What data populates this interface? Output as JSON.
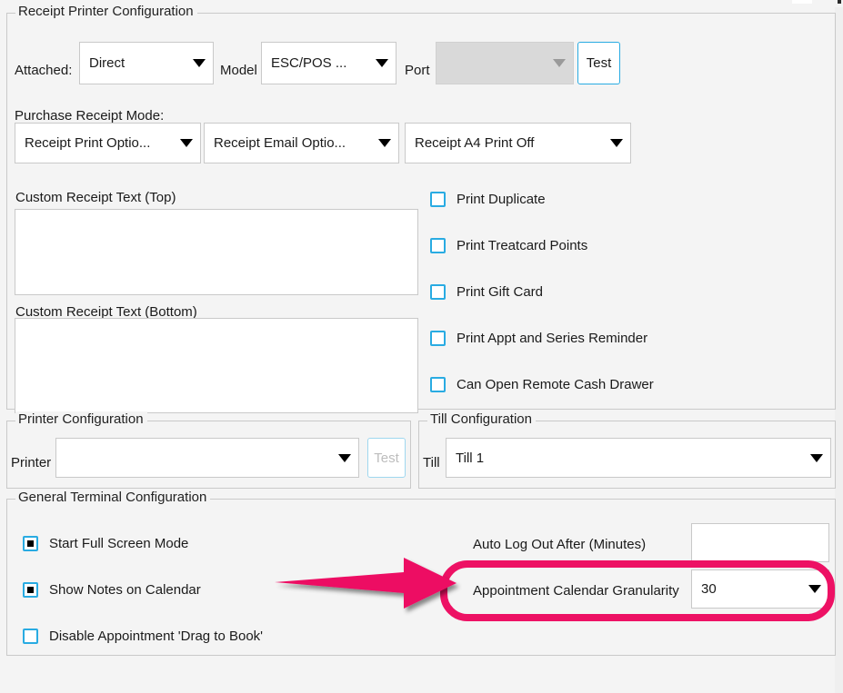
{
  "receipt_printer": {
    "legend": "Receipt Printer Configuration",
    "attached_label": "Attached:",
    "attached_value": "Direct",
    "model_label": "Model",
    "model_value": "ESC/POS ...",
    "port_label": "Port",
    "port_value": "",
    "test_button": "Test",
    "purchase_mode_label": "Purchase Receipt Mode:",
    "mode_print_value": "Receipt Print Optio...",
    "mode_email_value": "Receipt Email Optio...",
    "mode_a4_value": "Receipt A4 Print Off",
    "custom_top_label": "Custom Receipt Text (Top)",
    "custom_top_value": "",
    "custom_bottom_label": "Custom Receipt Text (Bottom)",
    "custom_bottom_value": "",
    "checkboxes": [
      {
        "label": "Print Duplicate",
        "checked": false
      },
      {
        "label": "Print Treatcard Points",
        "checked": false
      },
      {
        "label": "Print Gift Card",
        "checked": false
      },
      {
        "label": "Print Appt and Series Reminder",
        "checked": false
      },
      {
        "label": "Can Open Remote Cash Drawer",
        "checked": false
      }
    ]
  },
  "printer_config": {
    "legend": "Printer Configuration",
    "printer_label": "Printer",
    "printer_value": "",
    "test_button": "Test"
  },
  "till_config": {
    "legend": "Till Configuration",
    "till_label": "Till",
    "till_value": "Till 1"
  },
  "general_terminal": {
    "legend": "General Terminal Configuration",
    "checkboxes": [
      {
        "label": "Start Full Screen Mode",
        "checked": true
      },
      {
        "label": "Show Notes on Calendar",
        "checked": true
      },
      {
        "label": "Disable Appointment 'Drag to Book'",
        "checked": false
      }
    ],
    "auto_logout_label": "Auto Log Out After (Minutes)",
    "auto_logout_value": "",
    "granularity_label": "Appointment Calendar Granularity",
    "granularity_value": "30"
  },
  "colors": {
    "background": "#f4f4f4",
    "accent_checkbox": "#29ABE2",
    "annotation": "#ED1164",
    "field_border": "#c9c9c9",
    "disabled_field": "#d9d9d9"
  }
}
